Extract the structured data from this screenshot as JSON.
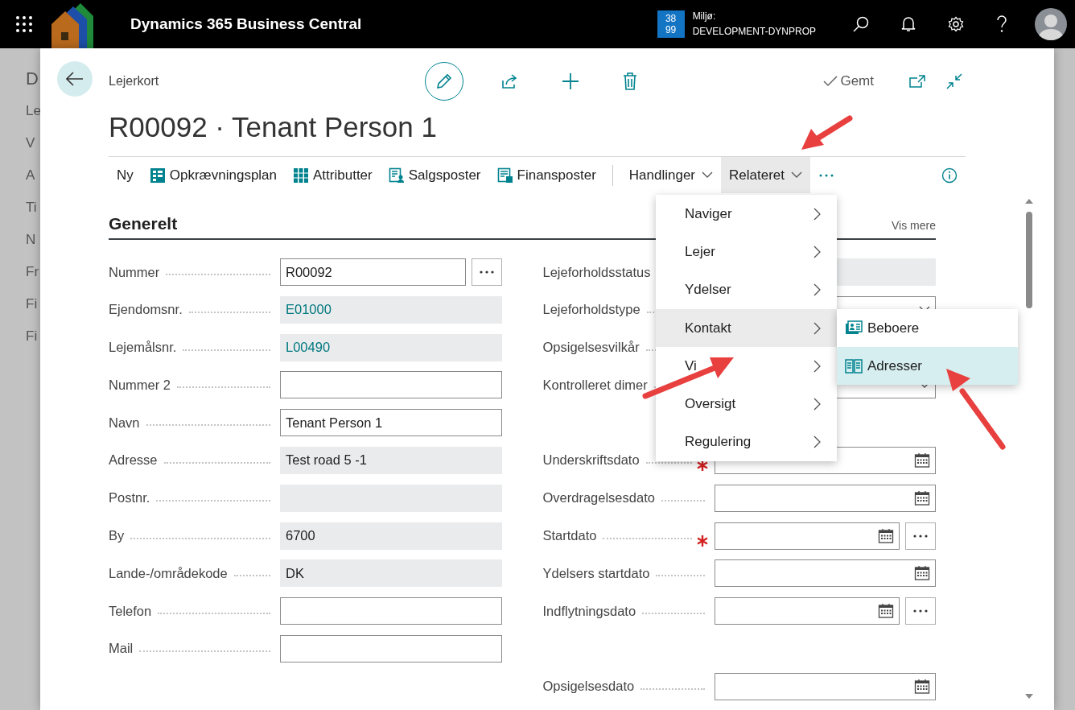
{
  "top_bar": {
    "title": "Dynamics 365 Business Central",
    "environment_badge": [
      "38",
      "99"
    ],
    "environment_label": "Miljø:",
    "environment_name": "DEVELOPMENT-DYNPROP"
  },
  "background_page": {
    "texts": [
      "D",
      "Le",
      "V",
      "A",
      "Ti",
      "N",
      "Fr",
      "Fi",
      "Fi"
    ]
  },
  "card": {
    "breadcrumb": "Lejerkort",
    "title": "R00092 · Tenant Person 1",
    "save_status": "Gemt",
    "actions": [
      {
        "kind": "button",
        "label": "Ny"
      },
      {
        "kind": "icon_button",
        "label": "Opkrævningsplan"
      },
      {
        "kind": "icon_button",
        "label": "Attributter"
      },
      {
        "kind": "icon_button",
        "label": "Salgsposter"
      },
      {
        "kind": "icon_button",
        "label": "Finansposter"
      },
      {
        "kind": "dropdown",
        "label": "Handlinger",
        "expanded": false
      },
      {
        "kind": "dropdown",
        "label": "Relateret",
        "expanded": true
      },
      {
        "kind": "more"
      }
    ],
    "section": {
      "title": "Generelt",
      "link": "Vis mere"
    },
    "left_fields": [
      {
        "label": "Nummer",
        "kind": "input",
        "value": "R00092",
        "lookup": true
      },
      {
        "label": "Ejendomsnr.",
        "kind": "link",
        "value": "E01000"
      },
      {
        "label": "Lejemålsnr.",
        "kind": "link",
        "value": "L00490"
      },
      {
        "label": "Nummer 2",
        "kind": "input"
      },
      {
        "label": "Navn",
        "kind": "input",
        "value": "Tenant Person 1"
      },
      {
        "label": "Adresse",
        "kind": "readonly",
        "value": "Test road 5 -1"
      },
      {
        "label": "Postnr.",
        "kind": "readonly"
      },
      {
        "label": "By",
        "kind": "readonly",
        "value": "6700"
      },
      {
        "label": "Lande-/områdekode",
        "kind": "readonly",
        "value": "DK"
      },
      {
        "label": "Telefon",
        "kind": "input"
      },
      {
        "label": "Mail",
        "kind": "input"
      }
    ],
    "right_groups": [
      [
        {
          "label": "Lejeforholdsstatus",
          "kind": "readonly"
        },
        {
          "label": "Lejeforholdstype",
          "kind": "dropdown"
        },
        {
          "label": "Opsigelsesvilkår",
          "kind": "input"
        },
        {
          "label": "Kontrolleret dimer",
          "kind": "dropdown"
        }
      ],
      [
        {
          "label": "Underskriftsdato",
          "kind": "date",
          "required": true
        },
        {
          "label": "Overdragelsesdato",
          "kind": "date"
        },
        {
          "label": "Startdato",
          "kind": "date",
          "required": true,
          "lookup": true
        },
        {
          "label": "Ydelsers startdato",
          "kind": "date"
        },
        {
          "label": "Indflytningsdato",
          "kind": "date",
          "lookup": true
        }
      ],
      [
        {
          "label": "Opsigelsesdato",
          "kind": "date"
        }
      ]
    ]
  },
  "related_menu": {
    "items": [
      {
        "label": "Naviger",
        "selected": false
      },
      {
        "label": "Lejer",
        "selected": false
      },
      {
        "label": "Ydelser",
        "selected": false
      },
      {
        "label": "Kontakt",
        "selected": true
      },
      {
        "label": "Vi",
        "selected": false
      },
      {
        "label": "Oversigt",
        "selected": false
      },
      {
        "label": "Regulering",
        "selected": false
      }
    ],
    "submenu": [
      {
        "label": "Beboere",
        "selected": false
      },
      {
        "label": "Adresser",
        "selected": true
      }
    ]
  }
}
